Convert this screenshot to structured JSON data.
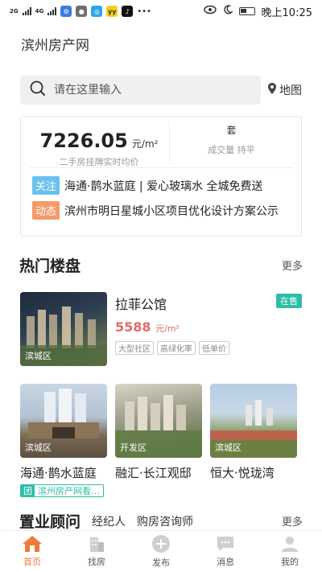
{
  "status_bar": {
    "signal1": "2G",
    "signal2": "4G",
    "time": "晚上10:25"
  },
  "app": {
    "title": "滨州房产网"
  },
  "search": {
    "placeholder": "请在这里输入",
    "map_label": "地图"
  },
  "price_card": {
    "price": "7226.05",
    "price_unit": "元/m²",
    "price_desc": "二手房挂牌实时均价",
    "volume_unit": "套",
    "volume_desc": "成交量 持平"
  },
  "news": [
    {
      "tag": "关注",
      "text": "海通·鹊水蓝庭 | 爱心玻璃水 全城免费送"
    },
    {
      "tag": "动态",
      "text": "滨州市明日星城小区项目优化设计方案公示"
    }
  ],
  "hot": {
    "title": "热门楼盘",
    "more": "更多",
    "featured": {
      "name": "拉菲公馆",
      "price": "5588",
      "price_unit": "元/m²",
      "status": "在售",
      "district": "滨城区",
      "tags": [
        "大型社区",
        "高绿化率",
        "低单价"
      ]
    },
    "items": [
      {
        "name": "海通·鹊水蓝庭",
        "district": "滨城区",
        "promo_icon": "团",
        "promo_text": "滨州房产网看…"
      },
      {
        "name": "融汇·长江观邸",
        "district": "开发区"
      },
      {
        "name": "恒大·悦珑湾",
        "district": "滨城区"
      }
    ]
  },
  "advisor": {
    "title": "置业顾问",
    "tabs": [
      "经纪人",
      "购房咨询师"
    ],
    "more": "更多"
  },
  "tabbar": [
    {
      "label": "首页",
      "icon": "home-icon",
      "active": true
    },
    {
      "label": "找房",
      "icon": "building-icon",
      "active": false
    },
    {
      "label": "发布",
      "icon": "plus-circle-icon",
      "active": false
    },
    {
      "label": "消息",
      "icon": "message-icon",
      "active": false
    },
    {
      "label": "我的",
      "icon": "user-icon",
      "active": false
    }
  ],
  "colors": {
    "accent": "#f07a3a",
    "teal": "#2dbda8",
    "price_red": "#e26a6a",
    "tag_blue": "#6ac1f0",
    "tag_orange": "#f49b6a"
  }
}
